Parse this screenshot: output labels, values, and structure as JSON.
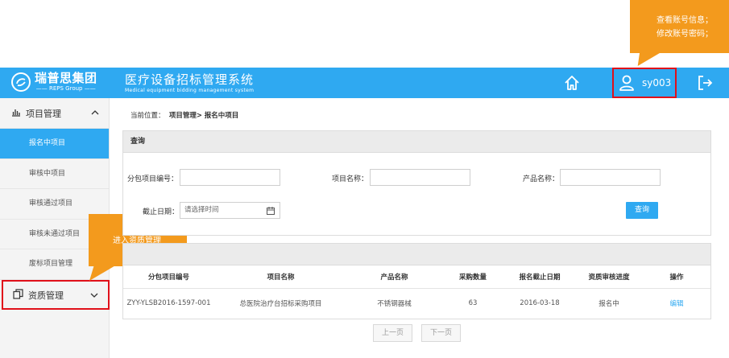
{
  "callouts": {
    "account": [
      "查看账号信息；",
      "修改账号密码；"
    ],
    "qualification": "进入资质管理"
  },
  "header": {
    "brand_cn": "瑞普思集团",
    "brand_en": "—— REPS Group ——",
    "system_cn": "医疗设备招标管理系统",
    "system_en": "Medical equipment bidding management system",
    "username": "sy003",
    "icons": [
      "home-icon",
      "user-icon",
      "logout-icon"
    ]
  },
  "sidebar": {
    "section_project": "项目管理",
    "items": [
      {
        "label": "报名中项目",
        "active": true
      },
      {
        "label": "审核中项目",
        "active": false
      },
      {
        "label": "审核通过项目",
        "active": false
      },
      {
        "label": "审核未通过项目",
        "active": false
      },
      {
        "label": "废标项目管理",
        "active": false
      }
    ],
    "section_qualification": "资质管理"
  },
  "breadcrumb": {
    "prefix": "当前位置：",
    "path": "项目管理>",
    "current": "报名中项目"
  },
  "query": {
    "title": "查询",
    "package_no_label": "分包项目编号：",
    "project_name_label": "项目名称：",
    "product_name_label": "产品名称：",
    "deadline_label": "截止日期：",
    "deadline_placeholder": "请选择时间",
    "search_button": "查询"
  },
  "results": {
    "columns": [
      "分包项目编号",
      "项目名称",
      "产品名称",
      "采购数量",
      "报名截止日期",
      "资质审核进度",
      "操作"
    ],
    "rows": [
      [
        "ZYY-YLSB2016-1597-001",
        "总医院治疗台招标采购项目",
        "不锈钢器械",
        "63",
        "2016-03-18",
        "报名中",
        "编辑"
      ]
    ]
  },
  "pager": {
    "prev": "上一页",
    "next": "下一页"
  },
  "colors": {
    "brand_blue": "#2fa9f1",
    "callout_orange": "#f39a1d",
    "highlight_red": "#e0101a"
  }
}
